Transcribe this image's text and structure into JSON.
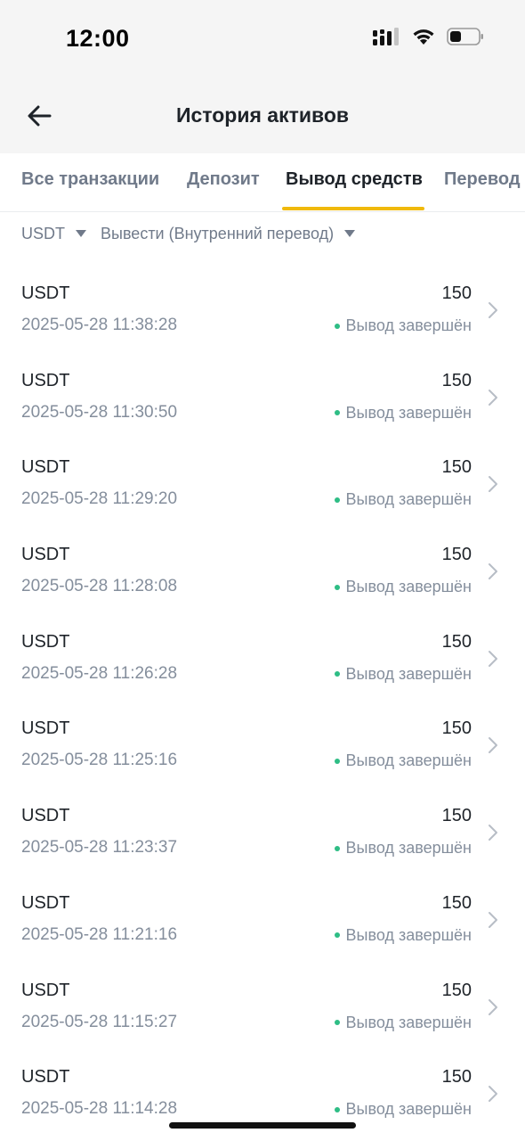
{
  "status_bar": {
    "time": "12:00"
  },
  "header": {
    "title": "История активов"
  },
  "tabs": [
    {
      "label": "Все транзакции",
      "active": false
    },
    {
      "label": "Депозит",
      "active": false
    },
    {
      "label": "Вывод средств",
      "active": true
    },
    {
      "label": "Перевод",
      "active": false
    }
  ],
  "filters": {
    "coin": "USDT",
    "type": "Вывести (Внутренний перевод)"
  },
  "colors": {
    "accent": "#f0b90b",
    "success": "#2ebd85",
    "muted": "#848e9c"
  },
  "transactions": [
    {
      "asset": "USDT",
      "date": "2025-05-28 11:38:28",
      "amount": "150",
      "status": "Вывод завершён"
    },
    {
      "asset": "USDT",
      "date": "2025-05-28 11:30:50",
      "amount": "150",
      "status": "Вывод завершён"
    },
    {
      "asset": "USDT",
      "date": "2025-05-28 11:29:20",
      "amount": "150",
      "status": "Вывод завершён"
    },
    {
      "asset": "USDT",
      "date": "2025-05-28 11:28:08",
      "amount": "150",
      "status": "Вывод завершён"
    },
    {
      "asset": "USDT",
      "date": "2025-05-28 11:26:28",
      "amount": "150",
      "status": "Вывод завершён"
    },
    {
      "asset": "USDT",
      "date": "2025-05-28 11:25:16",
      "amount": "150",
      "status": "Вывод завершён"
    },
    {
      "asset": "USDT",
      "date": "2025-05-28 11:23:37",
      "amount": "150",
      "status": "Вывод завершён"
    },
    {
      "asset": "USDT",
      "date": "2025-05-28 11:21:16",
      "amount": "150",
      "status": "Вывод завершён"
    },
    {
      "asset": "USDT",
      "date": "2025-05-28 11:15:27",
      "amount": "150",
      "status": "Вывод завершён"
    },
    {
      "asset": "USDT",
      "date": "2025-05-28 11:14:28",
      "amount": "150",
      "status": "Вывод завершён"
    }
  ]
}
